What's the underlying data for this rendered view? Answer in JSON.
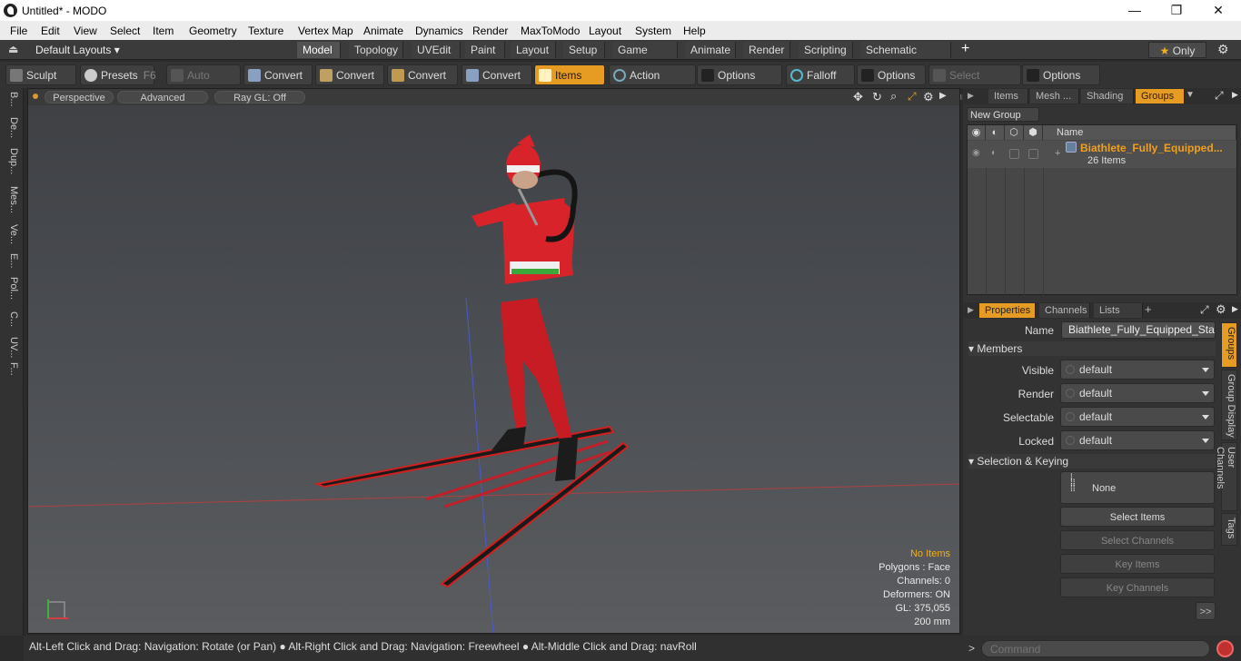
{
  "window": {
    "title": "Untitled* - MODO",
    "minimize": "—",
    "maximize": "❐",
    "close": "✕"
  },
  "menu": [
    "File",
    "Edit",
    "View",
    "Select",
    "Item",
    "Geometry",
    "Texture",
    "Vertex Map",
    "Animate",
    "Dynamics",
    "Render",
    "MaxToModo",
    "Layout",
    "System",
    "Help"
  ],
  "layoutbar": {
    "layouts_label": "Default Layouts",
    "tabs": [
      "Model",
      "Topology",
      "UVEdit",
      "Paint",
      "Layout",
      "Setup",
      "Game Tools",
      "Animate",
      "Render",
      "Scripting",
      "Schematic Fusion"
    ],
    "active_tab": "Model",
    "plus": "+",
    "only_label": "Only"
  },
  "toolbar": {
    "sculpt": "Sculpt",
    "presets": "Presets",
    "presets_hotkey": "F6",
    "auto_select": "Auto Select",
    "convert1": "Convert",
    "convert2": "Convert",
    "convert3": "Convert",
    "convert4": "Convert",
    "items": "Items",
    "action_center": "Action Center",
    "options1": "Options",
    "falloff": "Falloff",
    "options2": "Options",
    "select_through": "Select Through",
    "options3": "Options"
  },
  "left_tabs": [
    "B...",
    "De...",
    "Dup...",
    "Mes...",
    "Ve...",
    "E...",
    "Pol...",
    "C...",
    "UV...",
    "F..."
  ],
  "viewport": {
    "perspective": "Perspective",
    "advanced": "Advanced",
    "raygl": "Ray GL: Off",
    "info": {
      "no_items": "No Items",
      "polygons": "Polygons : Face",
      "channels": "Channels: 0",
      "deformers": "Deformers: ON",
      "gl": "GL: 375,055",
      "scale": "200 mm"
    }
  },
  "statusbar": "Alt-Left Click and Drag: Navigation: Rotate (or Pan) ● Alt-Right Click and Drag: Navigation: Freewheel ● Alt-Middle Click and Drag: navRoll",
  "groups_panel": {
    "tabs": [
      "Items",
      "Mesh ...",
      "Shading",
      "Groups"
    ],
    "active_tab": "Groups",
    "new_group": "New Group",
    "name_col": "Name",
    "group_name": "Biathlete_Fully_Equipped...",
    "group_count": "26 Items"
  },
  "properties": {
    "tabs": [
      "Properties",
      "Channels",
      "Lists"
    ],
    "active_tab": "Properties",
    "name_label": "Name",
    "name_value": "Biathlete_Fully_Equipped_Standi",
    "members_section": "Members",
    "visible_label": "Visible",
    "visible_value": "default",
    "render_label": "Render",
    "render_value": "default",
    "selectable_label": "Selectable",
    "selectable_value": "default",
    "locked_label": "Locked",
    "locked_value": "default",
    "selkey_section": "Selection & Keying",
    "none_label": "None",
    "select_items": "Select Items",
    "select_channels": "Select Channels",
    "key_items": "Key Items",
    "key_channels": "Key Channels",
    "more": ">>",
    "side_tabs": [
      "Groups",
      "Group Display",
      "User Channels",
      "Tags"
    ]
  },
  "command": {
    "placeholder": "Command",
    "prompt": ">"
  },
  "colors": {
    "accent": "#e69b22",
    "suit": "#d8232a"
  }
}
